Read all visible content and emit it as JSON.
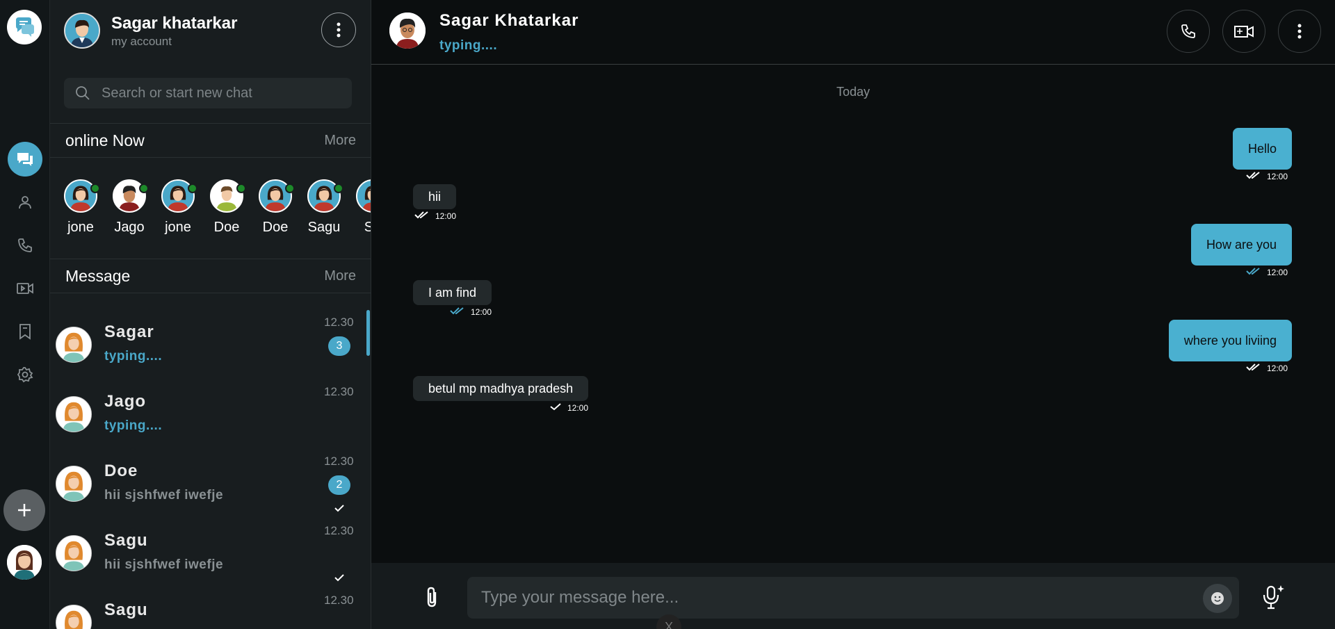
{
  "me": {
    "name": "Sagar khatarkar",
    "subtitle": "my account"
  },
  "search": {
    "placeholder": "Search or start new chat"
  },
  "online": {
    "title": "online Now",
    "more": "More",
    "users": [
      {
        "name": "jone",
        "gender": "female"
      },
      {
        "name": "Jago",
        "gender": "male"
      },
      {
        "name": "jone",
        "gender": "female"
      },
      {
        "name": "Doe",
        "gender": "male-light"
      },
      {
        "name": "Doe",
        "gender": "female"
      },
      {
        "name": "Sagu",
        "gender": "female"
      },
      {
        "name": "Sa",
        "gender": "female"
      }
    ]
  },
  "messages_section": {
    "title": "Message",
    "more": "More"
  },
  "chats": [
    {
      "name": "Sagar",
      "preview": "typing....",
      "typing": true,
      "time": "12.30",
      "badge": "3",
      "tick": false
    },
    {
      "name": "Jago",
      "preview": "typing....",
      "typing": true,
      "time": "12.30",
      "badge": "",
      "tick": false
    },
    {
      "name": "Doe",
      "preview": "hii sjshfwef iwefje",
      "typing": false,
      "time": "12.30",
      "badge": "2",
      "tick": true
    },
    {
      "name": "Sagu",
      "preview": "hii sjshfwef iwefje",
      "typing": false,
      "time": "12.30",
      "badge": "",
      "tick": true
    },
    {
      "name": "Sagu",
      "preview": "",
      "typing": false,
      "time": "12.30",
      "badge": "",
      "tick": false
    }
  ],
  "conversation": {
    "name": "Sagar Khatarkar",
    "status": "typing....",
    "day": "Today",
    "messages": [
      {
        "dir": "out",
        "text": "Hello",
        "time": "12:00",
        "ticks": "double-white"
      },
      {
        "dir": "in",
        "text": "hii",
        "time": "12:00",
        "ticks": "double-white"
      },
      {
        "dir": "out",
        "text": "How are you",
        "time": "12:00",
        "ticks": "double-blue"
      },
      {
        "dir": "in",
        "text": "I am find",
        "time": "12:00",
        "ticks": "double-blue"
      },
      {
        "dir": "out",
        "text": "where you liviing",
        "time": "12:00",
        "ticks": "double-white"
      },
      {
        "dir": "in",
        "text": "betul mp madhya pradesh",
        "time": "12:00",
        "ticks": "single-white"
      }
    ]
  },
  "composer": {
    "placeholder": "Type your message here...",
    "close_glyph": "X"
  },
  "colors": {
    "accent": "#4aa8c9",
    "online": "#1d8a2a",
    "bg": "#0b0e0f",
    "panel": "#181d1f"
  },
  "icons": {
    "rail": [
      "chat-logo-icon",
      "chats-icon",
      "contacts-icon",
      "phone-icon",
      "video-icon",
      "bookmark-icon",
      "settings-icon",
      "plus-icon"
    ],
    "header": [
      "phone-icon",
      "video-call-icon",
      "more-vertical-icon"
    ],
    "composer": [
      "attach-icon",
      "emoji-icon",
      "mic-icon"
    ]
  }
}
